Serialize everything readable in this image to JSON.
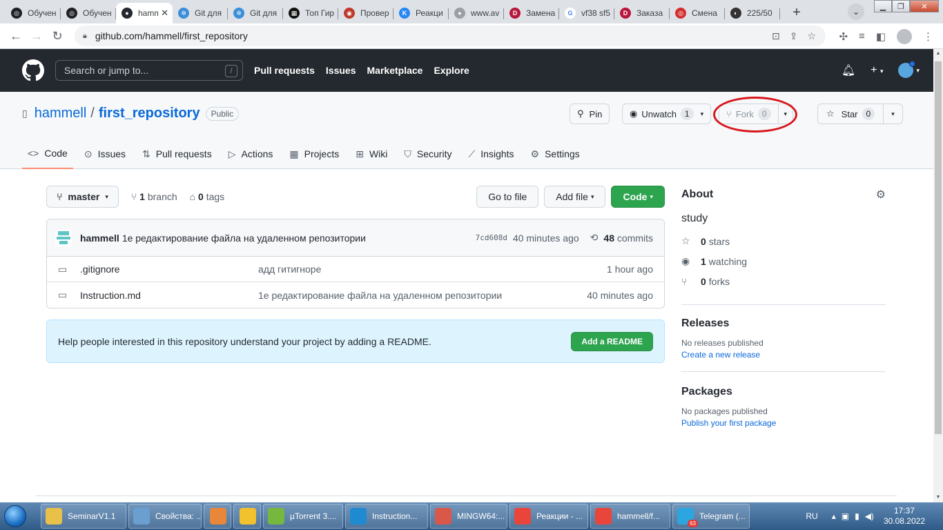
{
  "browser": {
    "tabs": [
      {
        "label": "Обучен",
        "color": "#202124",
        "glyph": "◎"
      },
      {
        "label": "Обучен",
        "color": "#202124",
        "glyph": "◎"
      },
      {
        "label": "hammell/first_repository",
        "color": "#24292f",
        "glyph": "●",
        "active": true
      },
      {
        "label": "Git для",
        "color": "#3b8ed8",
        "glyph": "✲"
      },
      {
        "label": "Git для",
        "color": "#3b8ed8",
        "glyph": "✲"
      },
      {
        "label": "Топ Гир",
        "color": "#111111",
        "glyph": "▦"
      },
      {
        "label": "Провер",
        "color": "#c0392b",
        "glyph": "◉"
      },
      {
        "label": "Реакци",
        "color": "#2787f5",
        "glyph": "K"
      },
      {
        "label": "www.av",
        "color": "#9aa0a6",
        "glyph": "●"
      },
      {
        "label": "Замена",
        "color": "#b8163c",
        "glyph": "D"
      },
      {
        "label": "vf38 sf5",
        "color": "#ffffff",
        "glyph": "G"
      },
      {
        "label": "Заказа",
        "color": "#b8163c",
        "glyph": "D"
      },
      {
        "label": "Смена",
        "color": "#d32f2f",
        "glyph": "◎"
      },
      {
        "label": "225/50",
        "color": "#333333",
        "glyph": "◐"
      }
    ],
    "new_tab": "+",
    "tab_search": "⌄",
    "url": "github.com/hammell/first_repository"
  },
  "github": {
    "search_placeholder": "Search or jump to...",
    "search_key": "/",
    "nav": [
      "Pull requests",
      "Issues",
      "Marketplace",
      "Explore"
    ]
  },
  "repo": {
    "owner": "hammell",
    "separator": "/",
    "name": "first_repository",
    "visibility": "Public",
    "pin_label": "Pin",
    "watch_label": "Unwatch",
    "watch_count": "1",
    "fork_label": "Fork",
    "fork_count": "0",
    "star_label": "Star",
    "star_count": "0",
    "tabs": [
      {
        "label": "Code",
        "icon": "<>"
      },
      {
        "label": "Issues",
        "icon": "⊙"
      },
      {
        "label": "Pull requests",
        "icon": "⇅"
      },
      {
        "label": "Actions",
        "icon": "▷"
      },
      {
        "label": "Projects",
        "icon": "▦"
      },
      {
        "label": "Wiki",
        "icon": "⊞"
      },
      {
        "label": "Security",
        "icon": "⛉"
      },
      {
        "label": "Insights",
        "icon": "⟋"
      },
      {
        "label": "Settings",
        "icon": "⚙"
      }
    ]
  },
  "code": {
    "branch": "master",
    "branch_count": "1",
    "branch_word": "branch",
    "tag_count": "0",
    "tag_word": "tags",
    "go_to_file": "Go to file",
    "add_file": "Add file",
    "code_button": "Code",
    "commit": {
      "user": "hammell",
      "message": "1е редактирование файла на удаленном репозитории",
      "sha": "7cd608d",
      "age": "40 minutes ago",
      "count": "48",
      "count_word": "commits"
    },
    "files": [
      {
        "name": ".gitignore",
        "message": "адд гитигноре",
        "age": "1 hour ago"
      },
      {
        "name": "Instruction.md",
        "message": "1е редактирование файла на удаленном репозитории",
        "age": "40 minutes ago"
      }
    ],
    "readme_prompt": "Help people interested in this repository understand your project by adding a README.",
    "readme_button": "Add a README"
  },
  "about": {
    "title": "About",
    "description": "study",
    "stars": {
      "count": "0",
      "word": "stars"
    },
    "watching": {
      "count": "1",
      "word": "watching"
    },
    "forks": {
      "count": "0",
      "word": "forks"
    },
    "releases_title": "Releases",
    "releases_empty": "No releases published",
    "releases_link": "Create a new release",
    "packages_title": "Packages",
    "packages_empty": "No packages published",
    "packages_link": "Publish your first package"
  },
  "taskbar": {
    "items": [
      {
        "label": "SeminarV1.1",
        "color": "#e8c04a",
        "width": 124
      },
      {
        "label": "Свойства: ...",
        "color": "#6a9fd0",
        "width": 106
      },
      {
        "label": "",
        "color": "#e8873a",
        "width": 40
      },
      {
        "label": "",
        "color": "#f2c12e",
        "width": 40
      },
      {
        "label": "µTorrent 3....",
        "color": "#76b83f",
        "width": 116
      },
      {
        "label": "Instruction...",
        "color": "#1f8ad2",
        "width": 120
      },
      {
        "label": "MINGW64:...",
        "color": "#d9584a",
        "width": 112
      },
      {
        "label": "Реакции - ...",
        "color": "#e9453a",
        "width": 114
      },
      {
        "label": "hammell/f...",
        "color": "#e9453a",
        "width": 116
      },
      {
        "label": "Telegram (...",
        "color": "#2ca5e0",
        "width": 112
      }
    ],
    "telegram_badge": "63",
    "lang": "RU",
    "time": "17:37",
    "date": "30.08.2022"
  },
  "colors": {
    "annotation_circle": "#d8161c",
    "code_button_green": "#2da44e",
    "link_blue": "#0969da"
  }
}
